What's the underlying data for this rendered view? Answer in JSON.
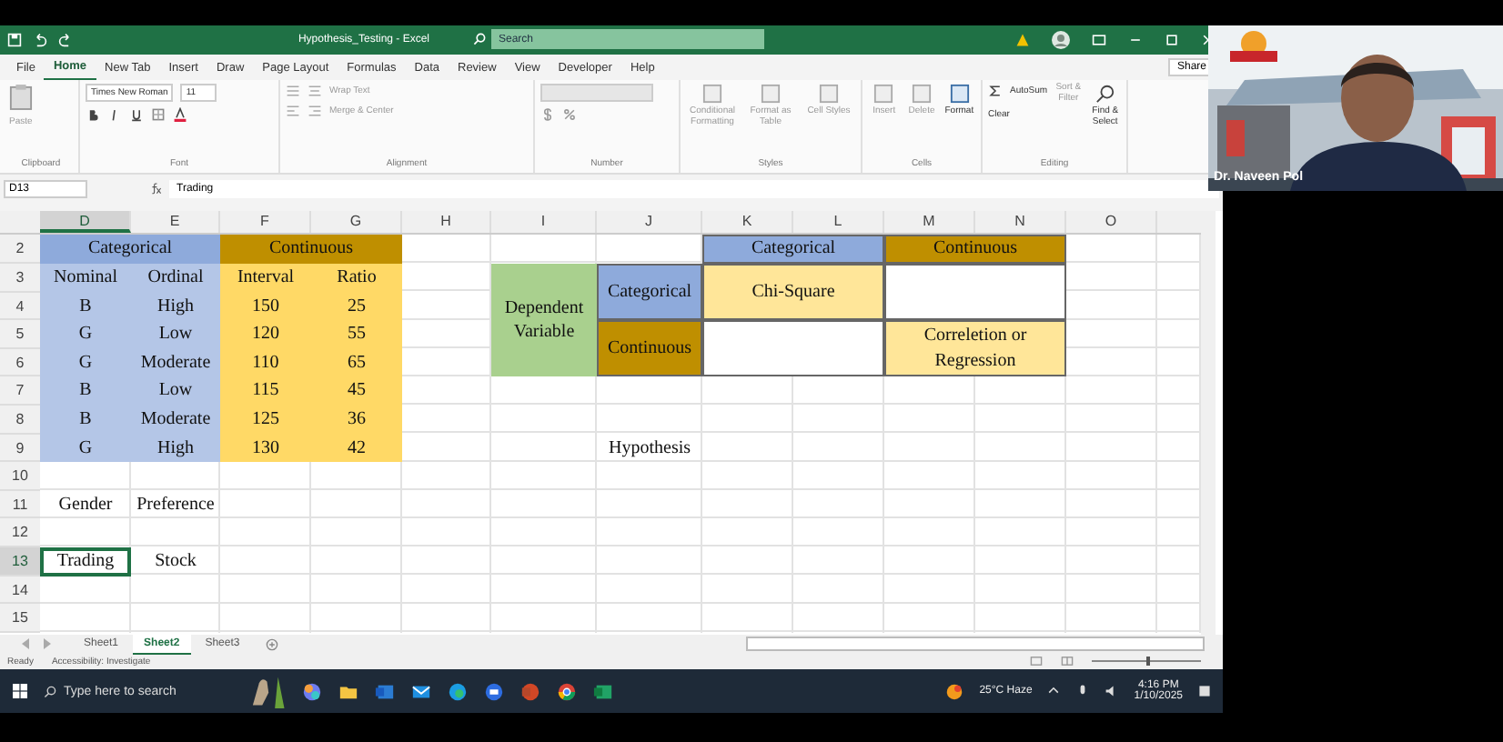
{
  "window": {
    "title": "Hypothesis_Testing - Excel",
    "search_placeholder": "Search"
  },
  "menu_tabs": [
    {
      "label": "File",
      "selected": false
    },
    {
      "label": "Home",
      "selected": true
    },
    {
      "label": "New Tab",
      "selected": false
    },
    {
      "label": "Insert",
      "selected": false
    },
    {
      "label": "Draw",
      "selected": false
    },
    {
      "label": "Page Layout",
      "selected": false
    },
    {
      "label": "Formulas",
      "selected": false
    },
    {
      "label": "Data",
      "selected": false
    },
    {
      "label": "Review",
      "selected": false
    },
    {
      "label": "View",
      "selected": false
    },
    {
      "label": "Developer",
      "selected": false
    },
    {
      "label": "Help",
      "selected": false
    }
  ],
  "share": "Share",
  "ribbon": {
    "paste": "Paste",
    "font_name": "Times New Roman",
    "font_size": "11",
    "wrap_text": "Wrap Text",
    "merge": "Merge & Center",
    "conditional": "Conditional Formatting",
    "format_table": "Format as Table",
    "cell_styles": "Cell Styles",
    "insert": "Insert",
    "delete": "Delete",
    "format": "Format",
    "autosum": "AutoSum",
    "clear": "Clear",
    "sort": "Sort & Filter",
    "find": "Find & Select",
    "groups": [
      "Clipboard",
      "Font",
      "Alignment",
      "Number",
      "Styles",
      "Cells",
      "Editing"
    ]
  },
  "formula_bar": {
    "name_box": "D13",
    "value": "Trading"
  },
  "columns": [
    {
      "label": "D",
      "selected": true
    },
    {
      "label": "E",
      "selected": false
    },
    {
      "label": "F",
      "selected": false
    },
    {
      "label": "G",
      "selected": false
    },
    {
      "label": "H",
      "selected": false
    },
    {
      "label": "I",
      "selected": false
    },
    {
      "label": "J",
      "selected": false
    },
    {
      "label": "K",
      "selected": false
    },
    {
      "label": "L",
      "selected": false
    },
    {
      "label": "M",
      "selected": false
    },
    {
      "label": "N",
      "selected": false
    },
    {
      "label": "O",
      "selected": false
    }
  ],
  "rows": [
    {
      "label": "2",
      "selected": false
    },
    {
      "label": "3",
      "selected": false
    },
    {
      "label": "4",
      "selected": false
    },
    {
      "label": "5",
      "selected": false
    },
    {
      "label": "6",
      "selected": false
    },
    {
      "label": "7",
      "selected": false
    },
    {
      "label": "8",
      "selected": false
    },
    {
      "label": "9",
      "selected": false
    },
    {
      "label": "10",
      "selected": false
    },
    {
      "label": "11",
      "selected": false
    },
    {
      "label": "12",
      "selected": false
    },
    {
      "label": "13",
      "selected": true
    },
    {
      "label": "14",
      "selected": false
    },
    {
      "label": "15",
      "selected": false
    }
  ],
  "left_table": {
    "groups": [
      {
        "text": "Categorical",
        "color": "#8eaadb"
      },
      {
        "text": "Continuous",
        "color": "#bf8f00"
      }
    ],
    "columns": [
      "Nominal",
      "Ordinal",
      "Interval",
      "Ratio"
    ],
    "rows": [
      [
        "B",
        "High",
        "150",
        "25"
      ],
      [
        "G",
        "Low",
        "120",
        "55"
      ],
      [
        "G",
        "Moderate",
        "110",
        "65"
      ],
      [
        "B",
        "Low",
        "115",
        "45"
      ],
      [
        "B",
        "Moderate",
        "125",
        "36"
      ],
      [
        "G",
        "High",
        "130",
        "42"
      ]
    ]
  },
  "right_table": {
    "row_title": "Dependent Variable",
    "column_heads": [
      {
        "text": "Categorical",
        "color": "#8eaadb"
      },
      {
        "text": "Continuous",
        "color": "#bf8f00"
      }
    ],
    "rows": [
      {
        "head": {
          "text": "Categorical",
          "color": "#8eaadb"
        },
        "cells": [
          {
            "kind": "text",
            "text": "Chi-Square"
          },
          {
            "kind": "empty"
          }
        ]
      },
      {
        "head": {
          "text": "Continuous",
          "color": "#bf8f00"
        },
        "cells": [
          {
            "kind": "empty"
          },
          {
            "kind": "text",
            "text": "Correletion or Regression"
          }
        ]
      }
    ]
  },
  "notes": [
    {
      "text": "Hypothesis",
      "selected": false
    },
    {
      "text": "Gender",
      "selected": false
    },
    {
      "text": "Preference",
      "selected": false
    },
    {
      "text": "Trading",
      "selected": true
    },
    {
      "text": "Stock",
      "selected": false
    }
  ],
  "sheet_tabs": [
    {
      "label": "Sheet1",
      "selected": false
    },
    {
      "label": "Sheet2",
      "selected": true
    },
    {
      "label": "Sheet3",
      "selected": false
    }
  ],
  "status_bar": {
    "ready": "Ready",
    "accessibility": "Accessibility: Investigate",
    "zoom": {
      "level": 0.5
    }
  },
  "taskbar": {
    "search_placeholder": "Type here to search",
    "weather": "25°C Haze",
    "time": "4:16 PM",
    "date": "1/10/2025"
  },
  "participant": {
    "name": "Dr. Naveen Pol"
  }
}
